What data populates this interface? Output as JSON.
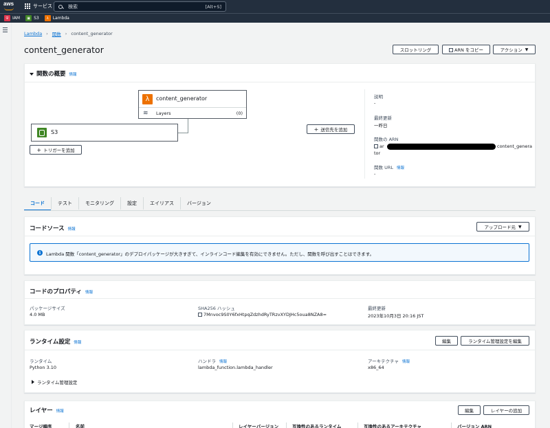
{
  "topnav": {
    "services_label": "サービス",
    "search_placeholder": "検索",
    "search_shortcut": "[Alt+S]",
    "favorites": [
      {
        "label": "IAM",
        "color": "#dd344c"
      },
      {
        "label": "S3",
        "color": "#3f8624"
      },
      {
        "label": "Lambda",
        "color": "#ed7100"
      }
    ]
  },
  "breadcrumb": {
    "items": [
      "Lambda",
      "関数",
      "content_generator"
    ]
  },
  "header": {
    "title": "content_generator",
    "throttle_label": "スロットリング",
    "copy_arn_label": "ARN をコピー",
    "actions_label": "アクション"
  },
  "overview": {
    "heading": "関数の概要",
    "info": "情報",
    "function_name": "content_generator",
    "layers_label": "Layers",
    "layers_count": "(0)",
    "trigger_name": "S3",
    "add_trigger_label": "トリガーを追加",
    "add_destination_label": "送信先を追加",
    "description_label": "説明",
    "description_value": "-",
    "last_modified_label": "最終更新",
    "last_modified_value": "一昨日",
    "arn_label": "関数の ARN",
    "arn_prefix": "ar",
    "arn_suffix": "content_genera",
    "arn_wrap": "tor",
    "url_label": "関数 URL",
    "url_info": "情報",
    "url_value": "-"
  },
  "tabs": [
    "コード",
    "テスト",
    "モニタリング",
    "設定",
    "エイリアス",
    "バージョン"
  ],
  "code_source": {
    "heading": "コードソース",
    "info": "情報",
    "upload_label": "アップロード元",
    "alert_text": "Lambda 関数「content_generator」のデプロイパッケージが大きすぎて、インラインコード編集を有効にできません。ただし、関数を呼び出すことはできます。"
  },
  "code_props": {
    "heading": "コードのプロパティ",
    "info": "情報",
    "pkg_size_label": "パッケージサイズ",
    "pkg_size_value": "4.0 MB",
    "sha_label": "SHA256 ハッシュ",
    "sha_value": "7Mnvoc9S0Y6fxHtpqZdzhdRyTRzvXYDJHc5oua8NZA8=",
    "last_modified_label": "最終更新",
    "last_modified_value": "2023年10月3日 20:16 JST"
  },
  "runtime": {
    "heading": "ランタイム設定",
    "info": "情報",
    "edit_label": "編集",
    "edit_mgmt_label": "ランタイム管理設定を編集",
    "runtime_label": "ランタイム",
    "runtime_value": "Python 3.10",
    "handler_label": "ハンドラ",
    "handler_info": "情報",
    "handler_value": "lambda_function.lambda_handler",
    "arch_label": "アーキテクチャ",
    "arch_info": "情報",
    "arch_value": "x86_64",
    "mgmt_expander": "ランタイム管理設定"
  },
  "layers": {
    "heading": "レイヤー",
    "info": "情報",
    "edit_label": "編集",
    "add_label": "レイヤーの追加",
    "columns": [
      "マージ順序",
      "名前",
      "レイヤーバージョン",
      "互換性のあるランタイム",
      "互換性のあるアーキテクチャ",
      "バージョン ARN"
    ]
  }
}
